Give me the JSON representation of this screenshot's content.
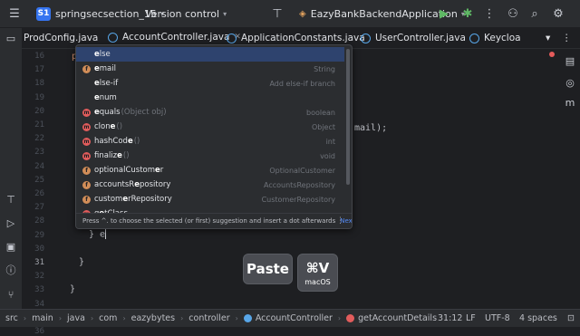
{
  "titlebar": {
    "project_badge": "S1",
    "project_name": "springsecsection_15",
    "vcs_label": "Version control",
    "run_config": "EazyBankBackendApplication"
  },
  "tabs": [
    {
      "label": "ProdConfig.java"
    },
    {
      "label": "AccountController.java",
      "active": true
    },
    {
      "label": "ApplicationConstants.java"
    },
    {
      "label": "UserController.java"
    },
    {
      "label": "Keycloa"
    }
  ],
  "editor": {
    "line_numbers": [
      "16",
      "17",
      "18",
      "19",
      "20",
      "21",
      "22",
      "23",
      "24",
      "25",
      "26",
      "27",
      "28",
      "29",
      "30",
      "31",
      "32",
      "33",
      "34",
      "35",
      "36"
    ],
    "partial_code_top": "p",
    "partial_code_right": "mail);",
    "current_line_text": "} e",
    "closing_brace_1": "}",
    "closing_brace_2": "}"
  },
  "autocomplete": {
    "items": [
      {
        "prefix": "",
        "bold": "e",
        "rest": "lse",
        "params": "",
        "type": "",
        "icon": "none",
        "selected": true
      },
      {
        "prefix": "",
        "bold": "e",
        "rest": "mail",
        "params": "",
        "type": "String",
        "icon": "f"
      },
      {
        "prefix": "",
        "bold": "e",
        "rest": "lse-if",
        "params": "",
        "type": "Add else-if branch",
        "icon": "none"
      },
      {
        "prefix": "",
        "bold": "e",
        "rest": "num",
        "params": "",
        "type": "",
        "icon": "none"
      },
      {
        "prefix": "",
        "bold": "e",
        "rest": "quals",
        "params": "(Object obj)",
        "type": "boolean",
        "icon": "m"
      },
      {
        "prefix": "clon",
        "bold": "e",
        "rest": "",
        "params": "()",
        "type": "Object",
        "icon": "m"
      },
      {
        "prefix": "hashCod",
        "bold": "e",
        "rest": "",
        "params": "()",
        "type": "int",
        "icon": "m"
      },
      {
        "prefix": "finaliz",
        "bold": "e",
        "rest": "",
        "params": "()",
        "type": "void",
        "icon": "m"
      },
      {
        "prefix": "optionalCustom",
        "bold": "e",
        "rest": "r",
        "params": "",
        "type": "OptionalCustomer",
        "icon": "f"
      },
      {
        "prefix": "accountsR",
        "bold": "e",
        "rest": "pository",
        "params": "",
        "type": "AccountsRepository",
        "icon": "f"
      },
      {
        "prefix": "custom",
        "bold": "e",
        "rest": "rRepository",
        "params": "",
        "type": "CustomerRepository",
        "icon": "f"
      },
      {
        "prefix": "g",
        "bold": "e",
        "rest": "tClass",
        "params": "",
        "type": "",
        "icon": "m"
      }
    ],
    "footer_hint": "Press ^. to choose the selected (or first) suggestion and insert a dot afterwards",
    "footer_next": "Next Tip"
  },
  "key_overlay": {
    "paste_label": "Paste",
    "shortcut": "⌘V",
    "os_label": "macOS"
  },
  "statusbar": {
    "breadcrumb": [
      "src",
      "main",
      "java",
      "com",
      "eazybytes",
      "controller",
      "AccountController",
      "getAccountDetails"
    ],
    "position": "31:12",
    "line_ending": "LF",
    "encoding": "UTF-8",
    "indent": "4 spaces"
  }
}
